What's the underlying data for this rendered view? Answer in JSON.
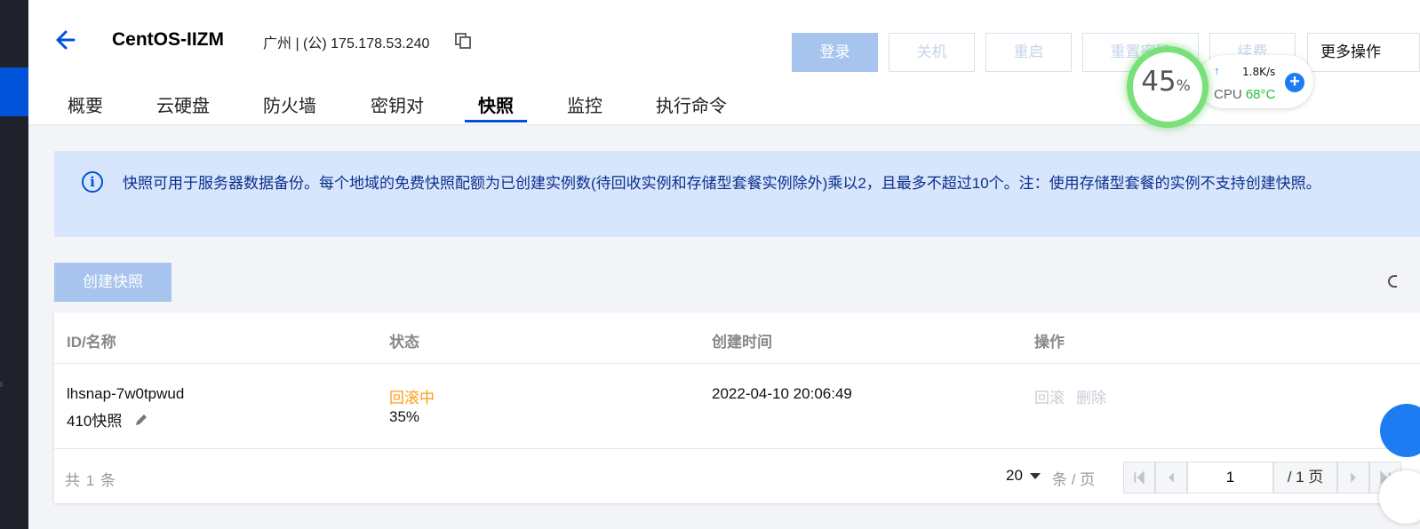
{
  "header": {
    "title": "CentOS-IIZM",
    "region_ip": "广州 | (公) 175.178.53.240",
    "buttons": {
      "login": "登录",
      "shutdown": "关机",
      "restart": "重启",
      "reset": "重置密码",
      "renew": "续费",
      "more": "更多操作"
    }
  },
  "tabs": [
    "概要",
    "云硬盘",
    "防火墙",
    "密钥对",
    "快照",
    "监控",
    "执行命令"
  ],
  "active_tab": "快照",
  "monitor_widget": {
    "percent": "45",
    "percent_unit": "%",
    "upload_speed": "1.8K/s",
    "cpu_label": "CPU",
    "cpu_temp": "68°C"
  },
  "notice": {
    "text": "快照可用于服务器数据备份。每个地域的免费快照配额为已创建实例数(待回收实例和存储型套餐实例除外)乘以2，且最多不超过10个。注：使用存储型套餐的实例不支持创建快照。"
  },
  "create_button": "创建快照",
  "table": {
    "headers": [
      "ID/名称",
      "状态",
      "创建时间",
      "操作"
    ],
    "rows": [
      {
        "id": "lhsnap-7w0tpwud",
        "name": "410快照",
        "status": "回滚中",
        "progress": "35%",
        "created": "2022-04-10 20:06:49",
        "actions": [
          "回滚",
          "删除"
        ]
      }
    ]
  },
  "pagination": {
    "total": "共 1 条",
    "page_size": "20",
    "per_page_label": "条 / 页",
    "current_page": "1",
    "total_pages": "/ 1 页"
  },
  "colors": {
    "primary": "#0052d9",
    "status_rolling": "#ff9c19",
    "notice_bg": "#d7e6fc",
    "disabled_primary": "#a7c4ee"
  }
}
